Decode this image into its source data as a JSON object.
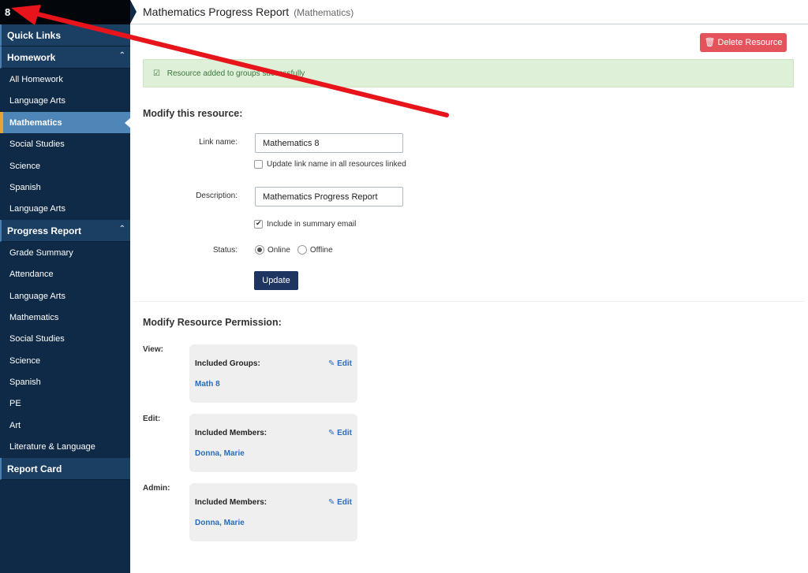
{
  "sidebar": {
    "top_label": "8",
    "sections": {
      "quick_links": "Quick Links",
      "homework": "Homework",
      "progress_report": "Progress Report",
      "report_card": "Report Card"
    },
    "homework_items": [
      "All Homework",
      "Language Arts",
      "Mathematics",
      "Social Studies",
      "Science",
      "Spanish",
      "Language Arts"
    ],
    "progress_items": [
      "Grade Summary",
      "Attendance",
      "Language Arts",
      "Mathematics",
      "Social Studies",
      "Science",
      "Spanish",
      "PE",
      "Art",
      "Literature & Language"
    ],
    "active_item": "Mathematics"
  },
  "header": {
    "title": "Mathematics Progress Report",
    "subtitle": "(Mathematics)"
  },
  "toolbar": {
    "delete_label": "Delete Resource"
  },
  "alert": {
    "message": "Resource added to groups successfully"
  },
  "form": {
    "heading": "Modify this resource:",
    "link_name_label": "Link name:",
    "link_name_value": "Mathematics 8",
    "update_link_label": "Update link name in all resources linked",
    "update_link_checked": false,
    "description_label": "Description:",
    "description_value": "Mathematics Progress Report",
    "summary_email_label": "Include in summary email",
    "summary_email_checked": true,
    "status_label": "Status:",
    "status_online": "Online",
    "status_offline": "Offline",
    "status_selected": "Online",
    "update_label": "Update"
  },
  "permissions": {
    "heading": "Modify Resource Permission:",
    "view": {
      "label": "View:",
      "title": "Included Groups:",
      "edit": "Edit",
      "value": "Math 8"
    },
    "edit": {
      "label": "Edit:",
      "title": "Included Members:",
      "edit": "Edit",
      "value": "Donna, Marie"
    },
    "admin": {
      "label": "Admin:",
      "title": "Included Members:",
      "edit": "Edit",
      "value": "Donna, Marie"
    }
  },
  "colors": {
    "sidebar_bg": "#0e2a47",
    "active_item_bg": "#4f86b8",
    "delete_button": "#e4525c",
    "update_button": "#1f3561",
    "alert_bg": "#dff0d8",
    "link_blue": "#2b6cb8",
    "annotation_arrow": "#e8141c"
  }
}
